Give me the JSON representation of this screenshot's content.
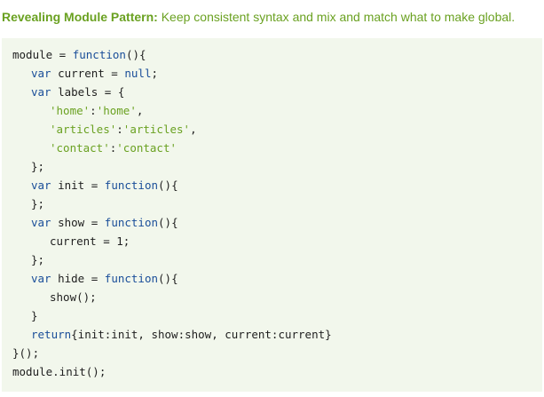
{
  "heading": {
    "label": "Revealing Module Pattern:",
    "description": " Keep consistent syntax and mix and match what to make global."
  },
  "code": {
    "lines": [
      {
        "indent": 0,
        "tokens": [
          {
            "t": "plain",
            "v": "module = "
          },
          {
            "t": "fn",
            "v": "function"
          },
          {
            "t": "plain",
            "v": "(){"
          }
        ]
      },
      {
        "indent": 1,
        "tokens": [
          {
            "t": "kw",
            "v": "var"
          },
          {
            "t": "plain",
            "v": " current = "
          },
          {
            "t": "nl",
            "v": "null"
          },
          {
            "t": "plain",
            "v": ";"
          }
        ]
      },
      {
        "indent": 1,
        "tokens": [
          {
            "t": "kw",
            "v": "var"
          },
          {
            "t": "plain",
            "v": " labels = {"
          }
        ]
      },
      {
        "indent": 2,
        "tokens": [
          {
            "t": "str",
            "v": "'home'"
          },
          {
            "t": "plain",
            "v": ":"
          },
          {
            "t": "str",
            "v": "'home'"
          },
          {
            "t": "plain",
            "v": ","
          }
        ]
      },
      {
        "indent": 2,
        "tokens": [
          {
            "t": "str",
            "v": "'articles'"
          },
          {
            "t": "plain",
            "v": ":"
          },
          {
            "t": "str",
            "v": "'articles'"
          },
          {
            "t": "plain",
            "v": ","
          }
        ]
      },
      {
        "indent": 2,
        "tokens": [
          {
            "t": "str",
            "v": "'contact'"
          },
          {
            "t": "plain",
            "v": ":"
          },
          {
            "t": "str",
            "v": "'contact'"
          }
        ]
      },
      {
        "indent": 1,
        "tokens": [
          {
            "t": "plain",
            "v": "};"
          }
        ]
      },
      {
        "indent": 1,
        "tokens": [
          {
            "t": "kw",
            "v": "var"
          },
          {
            "t": "plain",
            "v": " init = "
          },
          {
            "t": "fn",
            "v": "function"
          },
          {
            "t": "plain",
            "v": "(){"
          }
        ]
      },
      {
        "indent": 1,
        "tokens": [
          {
            "t": "plain",
            "v": "};"
          }
        ]
      },
      {
        "indent": 1,
        "tokens": [
          {
            "t": "kw",
            "v": "var"
          },
          {
            "t": "plain",
            "v": " show = "
          },
          {
            "t": "fn",
            "v": "function"
          },
          {
            "t": "plain",
            "v": "(){"
          }
        ]
      },
      {
        "indent": 2,
        "tokens": [
          {
            "t": "plain",
            "v": "current = 1;"
          }
        ]
      },
      {
        "indent": 1,
        "tokens": [
          {
            "t": "plain",
            "v": "};"
          }
        ]
      },
      {
        "indent": 1,
        "tokens": [
          {
            "t": "kw",
            "v": "var"
          },
          {
            "t": "plain",
            "v": " hide = "
          },
          {
            "t": "fn",
            "v": "function"
          },
          {
            "t": "plain",
            "v": "(){"
          }
        ]
      },
      {
        "indent": 2,
        "tokens": [
          {
            "t": "plain",
            "v": "show();"
          }
        ]
      },
      {
        "indent": 1,
        "tokens": [
          {
            "t": "plain",
            "v": "}"
          }
        ]
      },
      {
        "indent": 1,
        "tokens": [
          {
            "t": "kw",
            "v": "return"
          },
          {
            "t": "plain",
            "v": "{init:init, show:show, current:current}"
          }
        ]
      },
      {
        "indent": 0,
        "tokens": [
          {
            "t": "plain",
            "v": "}();"
          }
        ]
      },
      {
        "indent": 0,
        "tokens": [
          {
            "t": "plain",
            "v": "module.init();"
          }
        ]
      }
    ]
  },
  "colors": {
    "heading": "#6aa121",
    "code_background": "#f2f7ec",
    "keyword": "#1a4e99",
    "string": "#6aa121",
    "text": "#1f1f1f"
  }
}
